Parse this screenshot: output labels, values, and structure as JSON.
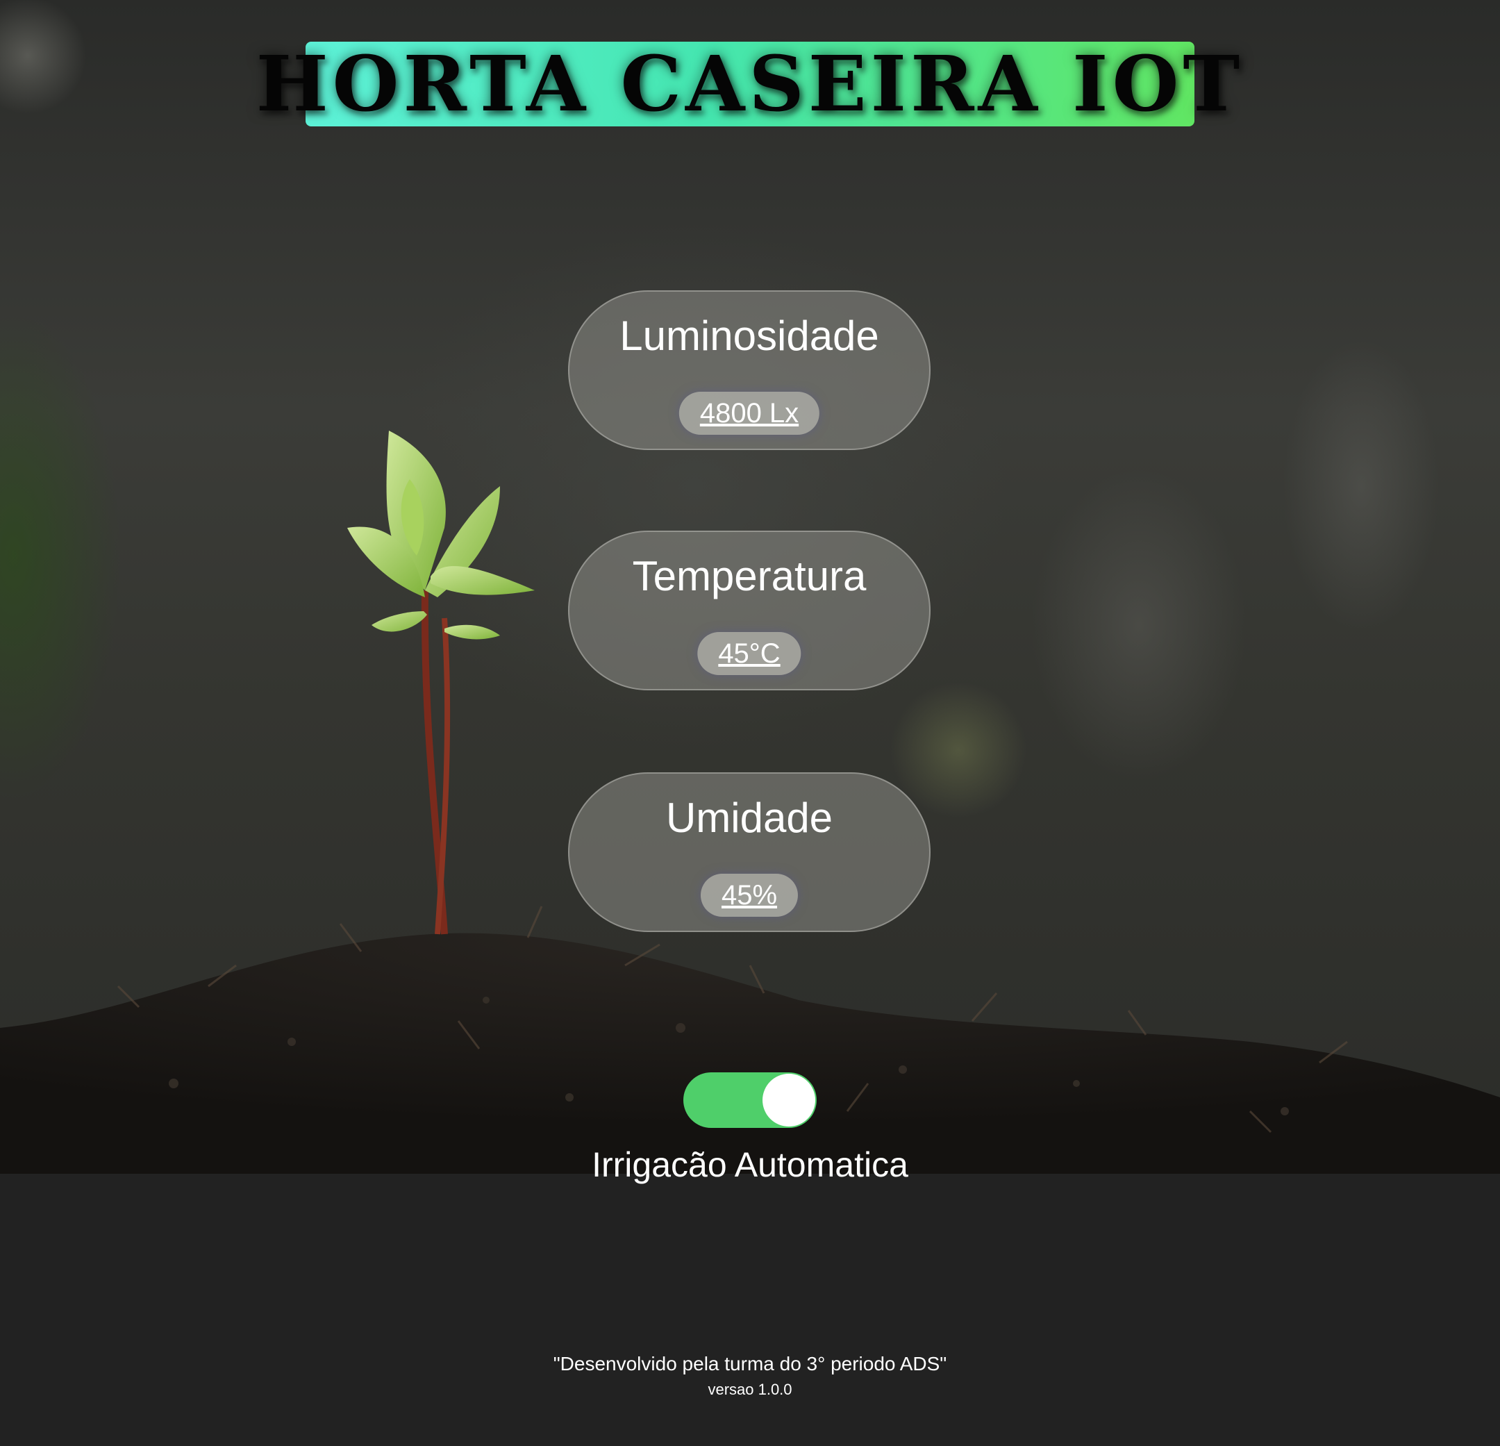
{
  "header": {
    "title": "HORTA CASEIRA IOT"
  },
  "sensors": [
    {
      "label": "Luminosidade",
      "value": "4800 Lx"
    },
    {
      "label": "Temperatura",
      "value": "45°C"
    },
    {
      "label": "Umidade",
      "value": "45%"
    }
  ],
  "irrigation": {
    "label": "Irrigacão Automatica",
    "enabled": true
  },
  "footer": {
    "credit": "\"Desenvolvido pela turma do 3° periodo ADS\"",
    "version": "versao 1.0.0"
  },
  "colors": {
    "banner_start": "#5ef2d8",
    "banner_end": "#61e663",
    "toggle_on": "#4fcf6a",
    "page_background": "#222222"
  }
}
